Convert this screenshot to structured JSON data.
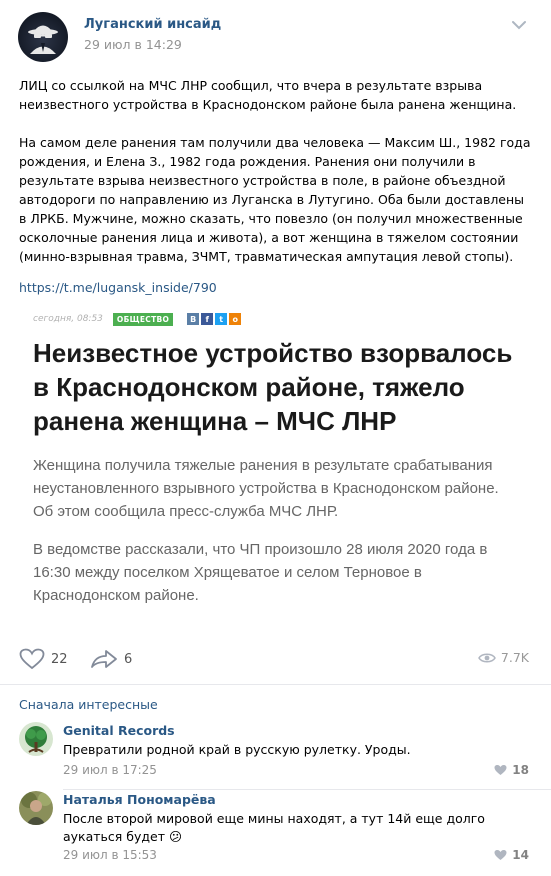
{
  "post": {
    "author": "Луганский инсайд",
    "date": "29 июл в 14:29",
    "paragraphs": [
      "ЛИЦ со ссылкой на МЧС ЛНР сообщил, что вчера в результате взрыва неизвестного устройства в Краснодонском районе была ранена женщина.",
      "На самом деле ранения там получили два человека — Максим Ш., 1982 года рождения, и Елена З., 1982 года рождения. Ранения они получили в результате взрыва неизвестного устройства в поле, в районе объездной автодороги по направлению из Луганска в Лутугино. Оба были доставлены в ЛРКБ. Мужчине, можно сказать, что повезло (он получил множественные осколочные ранения лица и живота), а вот женщина в тяжелом состоянии (минно-взрывная травма, ЗЧМТ, травматическая ампутация левой стопы)."
    ],
    "link": "https://t.me/lugansk_inside/790"
  },
  "article": {
    "date": "сегодня, 08:53",
    "tag": "ОБЩЕСТВО",
    "share": {
      "vk": "В",
      "fb": "f",
      "tw": "t",
      "ok": "о"
    },
    "title": "Неизвестное устройство взорвалось в Краснодонском районе, тяжело ранена женщина – МЧС ЛНР",
    "p1": "Женщина получила тяжелые ранения в результате срабатывания неустановленного взрывного устройства в Краснодонском районе. Об этом сообщила пресс-служба МЧС ЛНР.",
    "p2": "В ведомстве рассказали, что ЧП произошло 28 июля 2020 года в 16:30 между поселком Хрящеватое и селом Терновое в Краснодонском районе."
  },
  "actions": {
    "likes": "22",
    "shares": "6",
    "views": "7.7K"
  },
  "comments_sort": "Сначала интересные",
  "comments": [
    {
      "author": "Genital Records",
      "text": "Превратили родной край в русскую рулетку. Уроды.",
      "date": "29 июл в 17:25",
      "likes": "18"
    },
    {
      "author": "Наталья Пономарёва",
      "text": "После второй мировой еще мины находят, а тут 14й еще долго аукаться будет",
      "emoji": "😕",
      "date": "29 июл в 15:53",
      "likes": "14"
    }
  ],
  "colors": {
    "link": "#2a5885",
    "tag": "#4caf50",
    "muted": "#939393"
  }
}
